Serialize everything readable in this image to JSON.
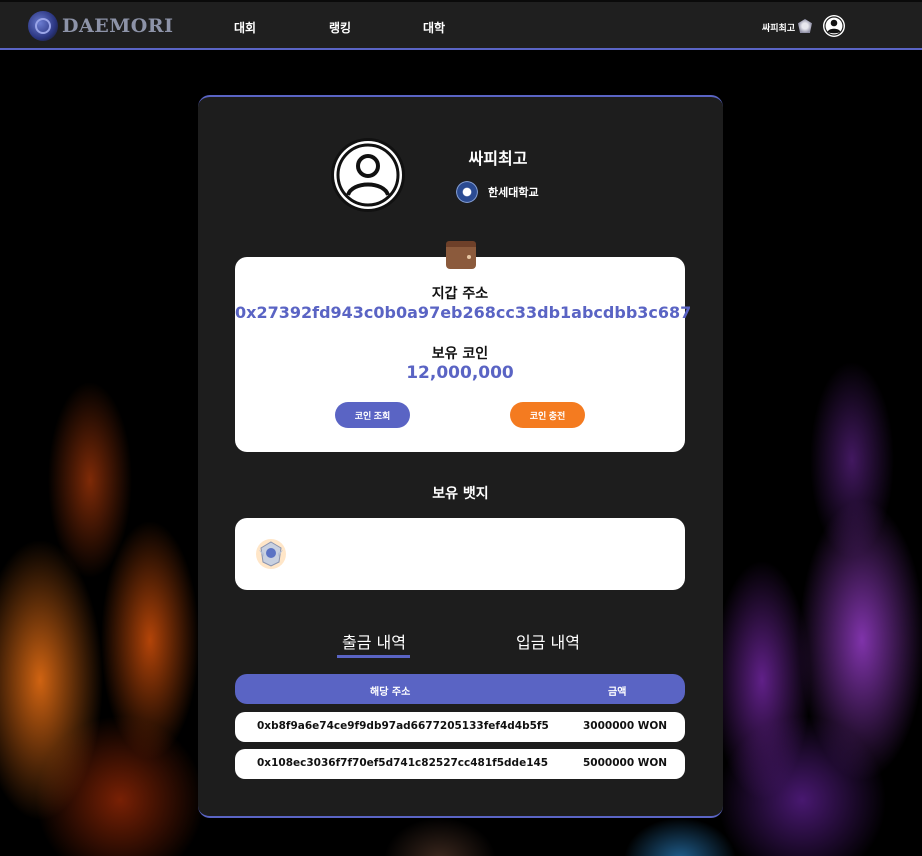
{
  "nav": {
    "logo_text": "DAEMORI",
    "links": [
      "대회",
      "랭킹",
      "대학"
    ],
    "user_name": "싸피최고"
  },
  "profile": {
    "username": "싸피최고",
    "university": "한세대학교"
  },
  "wallet": {
    "address_label": "지갑 주소",
    "address": "0x27392fd943c0b0a97eb268cc33db1abcdbb3c687",
    "coin_label": "보유 코인",
    "coin_amount": "12,000,000",
    "check_button": "코인 조회",
    "charge_button": "코인 충전"
  },
  "badges": {
    "title": "보유 뱃지"
  },
  "tabs": {
    "withdraw": "출금 내역",
    "deposit": "입금 내역",
    "active": "withdraw"
  },
  "table": {
    "headers": [
      "해당 주소",
      "금액"
    ],
    "rows": [
      {
        "address": "0xb8f9a6e74ce9f9db97ad6677205133fef4d4b5f5",
        "amount": "3000000 WON"
      },
      {
        "address": "0x108ec3036f7f70ef5d741c82527cc481f5dde145",
        "amount": "5000000 WON"
      }
    ]
  },
  "colors": {
    "accent": "#5a64c4",
    "charge_button": "#f47b20",
    "card_bg": "#1d1d1d"
  }
}
